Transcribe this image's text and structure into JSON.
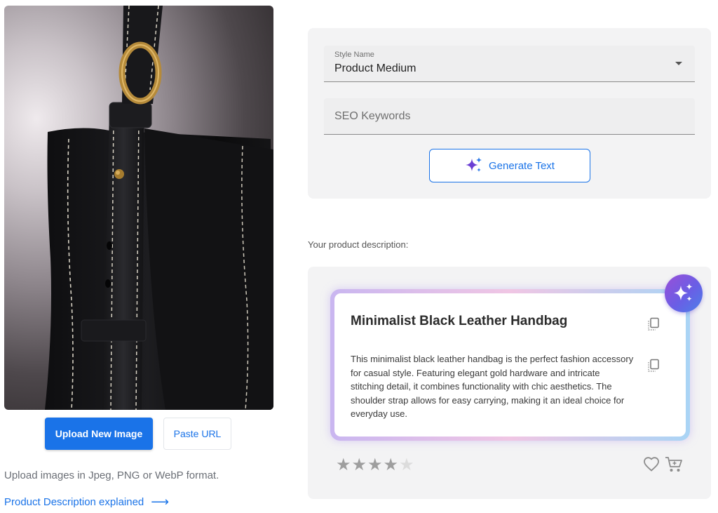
{
  "left": {
    "image_alt": "Black leather handbag product photo",
    "upload_button": "Upload New Image",
    "paste_button": "Paste URL",
    "hint": "Upload images in Jpeg, PNG or WebP format.",
    "explain_link": "Product Description explained",
    "explain_arrow": "⟶"
  },
  "settings": {
    "style_label": "Style Name",
    "style_value": "Product Medium",
    "seo_placeholder": "SEO Keywords",
    "seo_value": "",
    "generate_button": "Generate Text"
  },
  "result": {
    "heading": "Your product description:",
    "title": "Minimalist Black Leather Handbag",
    "body": "This minimalist black leather handbag is the perfect fashion accessory for casual style. Featuring elegant gold hardware and intricate stitching detail, it combines functionality with chic aesthetics. The shoulder strap allows for easy carrying, making it an ideal choice for everyday use.",
    "rating": 4,
    "rating_max": 5,
    "icons": {
      "sparkle": "sparkle-icon",
      "copy": "copy-icon",
      "heart": "heart-icon",
      "cart": "cart-icon"
    }
  },
  "colors": {
    "accent": "#1a73e8",
    "panel_bg": "#f3f3f4",
    "sparkle_start": "#9a4fd8",
    "sparkle_end": "#4c7fe9"
  }
}
